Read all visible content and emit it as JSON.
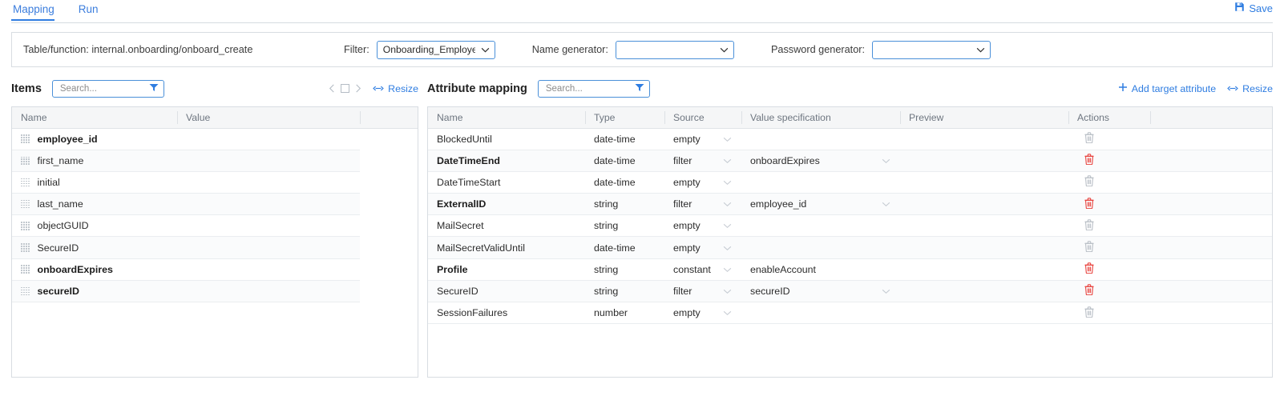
{
  "tabs": [
    {
      "label": "Mapping",
      "active": true
    },
    {
      "label": "Run",
      "active": false
    }
  ],
  "save": {
    "label": "Save",
    "icon": "save-icon",
    "color": "#2f7de1"
  },
  "info": {
    "table_function_label": "Table/function: internal.onboarding/onboard_create",
    "filter": {
      "label": "Filter:",
      "value": "Onboarding_Employee_C",
      "icon": "chevron-down-icon"
    },
    "name_generator": {
      "label": "Name generator:",
      "value": "",
      "icon": "chevron-down-icon"
    },
    "password_generator": {
      "label": "Password generator:",
      "value": "",
      "icon": "chevron-down-icon"
    }
  },
  "items_panel": {
    "title": "Items",
    "search": {
      "placeholder": "Search...",
      "value": "",
      "icon": "filter-funnel-icon"
    },
    "pager": {
      "prev_icon": "chevron-left-icon",
      "page_icon": "page-box-icon",
      "next_icon": "chevron-right-icon"
    },
    "resize": {
      "label": "Resize",
      "icon": "resize-arrows-icon"
    },
    "columns": [
      "Name",
      "Value"
    ],
    "rows": [
      {
        "name": "employee_id",
        "value": "",
        "bold": true,
        "handle": "drag-handle-icon"
      },
      {
        "name": "first_name",
        "value": "",
        "bold": false,
        "handle": "drag-handle-icon"
      },
      {
        "name": "initial",
        "value": "",
        "bold": false,
        "handle": "drag-handle-icon"
      },
      {
        "name": "last_name",
        "value": "",
        "bold": false,
        "handle": "drag-handle-icon"
      },
      {
        "name": "objectGUID",
        "value": "",
        "bold": false,
        "handle": "drag-handle-icon"
      },
      {
        "name": "SecureID",
        "value": "",
        "bold": false,
        "handle": "drag-handle-icon"
      },
      {
        "name": "onboardExpires",
        "value": "",
        "bold": true,
        "handle": "drag-handle-icon"
      },
      {
        "name": "secureID",
        "value": "",
        "bold": true,
        "handle": "drag-handle-icon"
      }
    ]
  },
  "mapping_panel": {
    "title": "Attribute mapping",
    "search": {
      "placeholder": "Search...",
      "value": "",
      "icon": "filter-funnel-icon"
    },
    "add_target_attribute": {
      "label": "Add target attribute",
      "icon": "plus-icon"
    },
    "resize": {
      "label": "Resize",
      "icon": "resize-arrows-icon"
    },
    "columns": [
      "Name",
      "Type",
      "Source",
      "Value specification",
      "Preview",
      "Actions"
    ],
    "rows": [
      {
        "name": "BlockedUntil",
        "type": "date-time",
        "source": "empty",
        "value_spec": "",
        "preview": "",
        "bold": false,
        "delete_active": false,
        "vspec_dropdown": false
      },
      {
        "name": "DateTimeEnd",
        "type": "date-time",
        "source": "filter",
        "value_spec": "onboardExpires",
        "preview": "",
        "bold": true,
        "delete_active": true,
        "vspec_dropdown": true
      },
      {
        "name": "DateTimeStart",
        "type": "date-time",
        "source": "empty",
        "value_spec": "",
        "preview": "",
        "bold": false,
        "delete_active": false,
        "vspec_dropdown": false
      },
      {
        "name": "ExternalID",
        "type": "string",
        "source": "filter",
        "value_spec": "employee_id",
        "preview": "",
        "bold": true,
        "delete_active": true,
        "vspec_dropdown": true
      },
      {
        "name": "MailSecret",
        "type": "string",
        "source": "empty",
        "value_spec": "",
        "preview": "",
        "bold": false,
        "delete_active": false,
        "vspec_dropdown": false
      },
      {
        "name": "MailSecretValidUntil",
        "type": "date-time",
        "source": "empty",
        "value_spec": "",
        "preview": "",
        "bold": false,
        "delete_active": false,
        "vspec_dropdown": false
      },
      {
        "name": "Profile",
        "type": "string",
        "source": "constant",
        "value_spec": "enableAccount",
        "preview": "",
        "bold": true,
        "delete_active": true,
        "vspec_dropdown": false
      },
      {
        "name": "SecureID",
        "type": "string",
        "source": "filter",
        "value_spec": "secureID",
        "preview": "",
        "bold": false,
        "delete_active": true,
        "vspec_dropdown": true
      },
      {
        "name": "SessionFailures",
        "type": "number",
        "source": "empty",
        "value_spec": "",
        "preview": "",
        "bold": false,
        "delete_active": false,
        "vspec_dropdown": false
      }
    ]
  },
  "colors": {
    "accent": "#2f7de1",
    "delete_active": "#e8413c",
    "delete_inactive": "#b9bfc6",
    "header_bg": "#f5f6f7",
    "border": "#d8dde2"
  }
}
